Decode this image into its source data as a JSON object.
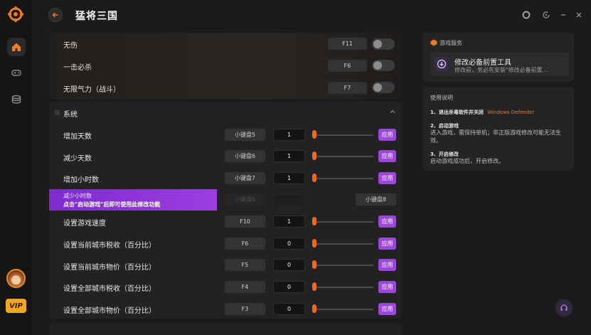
{
  "app": {
    "title": "猛将三国"
  },
  "cheats_top": [
    {
      "label": "无伤",
      "key": "F11"
    },
    {
      "label": "一击必杀",
      "key": "F6"
    },
    {
      "label": "无限气力（战斗）",
      "key": "F7"
    }
  ],
  "system": {
    "title": "系统",
    "apply_label": "应用",
    "rows": [
      {
        "label": "增加天数",
        "key": "小键盘5",
        "value": "1"
      },
      {
        "label": "减少天数",
        "key": "小键盘6",
        "value": "1"
      },
      {
        "label": "增加小时数",
        "key": "小键盘7",
        "value": "1"
      },
      {
        "label": "",
        "key": "小键盘8",
        "value": ""
      },
      {
        "label": "设置游戏速度",
        "key": "F10",
        "value": "1"
      },
      {
        "label": "设置当前城市税收（百分比）",
        "key": "F6",
        "value": "0"
      },
      {
        "label": "设置当前城市物价（百分比）",
        "key": "F5",
        "value": "0"
      },
      {
        "label": "设置全部城市税收（百分比）",
        "key": "F4",
        "value": "0"
      },
      {
        "label": "设置全部城市物价（百分比）",
        "key": "F3",
        "value": "0"
      }
    ],
    "tooltip": {
      "line1": "减少小时数",
      "line2": "点击\"启动游戏\"后即可使用此修改功能",
      "faded_key": "小键盘8"
    }
  },
  "game_service": {
    "title": "游戏服务",
    "item_title": "修改必备前置工具",
    "item_desc": "修改前，务必先安装\"修改必备前置..."
  },
  "instructions": {
    "title": "使用说明",
    "step1_head": "1、退出杀毒软件并关闭",
    "step1_link": "Windows Defender",
    "step2_head": "2、启动游戏",
    "step2_text": "进入游戏，需保持单机；非正版游戏修改可能无法生效。",
    "step3_head": "3、开启修改",
    "step3_text": "启动游戏成功后，开启修改。"
  },
  "badges": {
    "vip": "VIP"
  },
  "colors": {
    "accent_orange": "#f06a1e",
    "accent_purple": "#9b47d8",
    "link_orange": "#e8772a"
  }
}
